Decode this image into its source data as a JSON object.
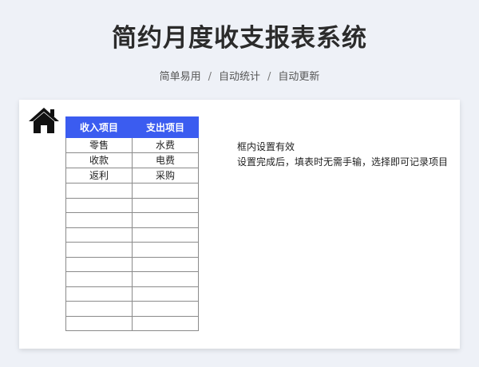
{
  "header": {
    "title": "简约月度收支报表系统",
    "subtitle_items": [
      "简单易用",
      "自动统计",
      "自动更新"
    ],
    "separator": "/"
  },
  "table": {
    "headers": [
      "收入项目",
      "支出项目"
    ],
    "header_color": "#3b5cf0",
    "rows": [
      [
        "零售",
        "水费"
      ],
      [
        "收款",
        "电费"
      ],
      [
        "返利",
        "采购"
      ],
      [
        "",
        ""
      ],
      [
        "",
        ""
      ],
      [
        "",
        ""
      ],
      [
        "",
        ""
      ],
      [
        "",
        ""
      ],
      [
        "",
        ""
      ],
      [
        "",
        ""
      ],
      [
        "",
        ""
      ],
      [
        "",
        ""
      ],
      [
        "",
        ""
      ]
    ]
  },
  "notes": {
    "line1": "框内设置有效",
    "line2": "设置完成后，填表时无需手输，选择即可记录项目"
  },
  "icons": {
    "home": "home-icon"
  }
}
